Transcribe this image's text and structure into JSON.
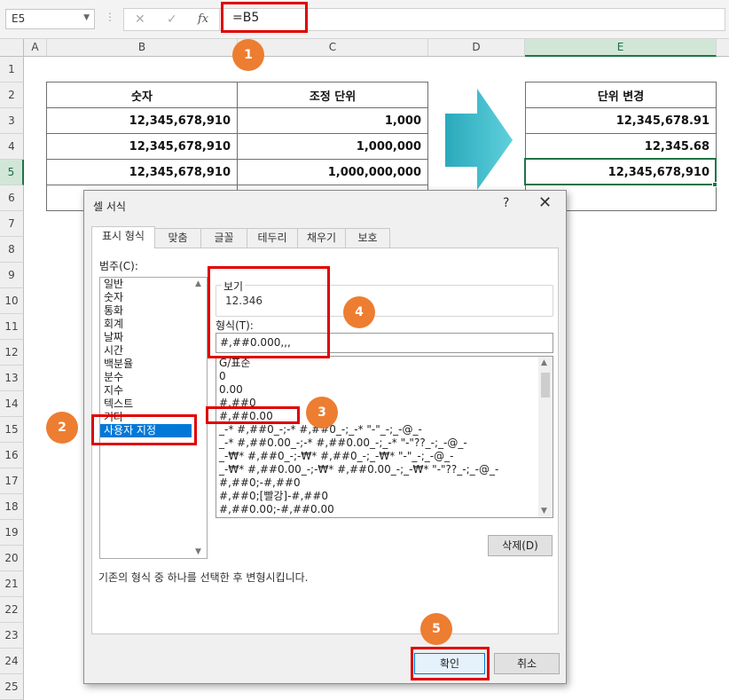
{
  "formula_bar": {
    "name_box": "E5",
    "cancel_icon": "✕",
    "enter_icon": "✓",
    "fx_icon": "fx",
    "formula": "=B5"
  },
  "columns": [
    "A",
    "B",
    "C",
    "D",
    "E"
  ],
  "rows": [
    "1",
    "2",
    "3",
    "4",
    "5",
    "6",
    "7",
    "8",
    "9",
    "10",
    "11",
    "12",
    "13",
    "14",
    "15",
    "16",
    "17",
    "18",
    "19",
    "20",
    "21",
    "22",
    "23",
    "24",
    "25"
  ],
  "left_table": {
    "headers": [
      "숫자",
      "조정 단위"
    ],
    "rows": [
      [
        "12,345,678,910",
        "1,000"
      ],
      [
        "12,345,678,910",
        "1,000,000"
      ],
      [
        "12,345,678,910",
        "1,000,000,000"
      ]
    ]
  },
  "right_table": {
    "header": "단위 변경",
    "values": [
      "12,345,678.91",
      "12,345.68",
      "12,345,678,910"
    ]
  },
  "dialog": {
    "title": "셀 서식",
    "help": "?",
    "close": "✕",
    "tabs": [
      "표시 형식",
      "맞춤",
      "글꼴",
      "테두리",
      "채우기",
      "보호"
    ],
    "category_label": "범주(C):",
    "categories": [
      "일반",
      "숫자",
      "통화",
      "회계",
      "날짜",
      "시간",
      "백분율",
      "분수",
      "지수",
      "텍스트",
      "기타",
      "사용자 지정"
    ],
    "selected_category": "사용자 지정",
    "sample_label": "보기",
    "sample_value": "12.346",
    "format_label": "형식(T):",
    "format_value": "#,##0.000,,,",
    "formats": [
      "G/표준",
      "0",
      "0.00",
      "#,##0",
      "#,##0.00",
      "_-* #,##0_-;-* #,##0_-;_-* \"-\"_-;_-@_-",
      "_-* #,##0.00_-;-* #,##0.00_-;_-* \"-\"??_-;_-@_-",
      "_-₩* #,##0_-;-₩* #,##0_-;_-₩* \"-\"_-;_-@_-",
      "_-₩* #,##0.00_-;-₩* #,##0.00_-;_-₩* \"-\"??_-;_-@_-",
      "#,##0;-#,##0",
      "#,##0;[빨강]-#,##0",
      "#,##0.00;-#,##0.00"
    ],
    "delete_button": "삭제(D)",
    "description": "기존의 형식 중 하나를 선택한 후 변형시킵니다.",
    "ok_button": "확인",
    "cancel_button": "취소"
  },
  "annotations": [
    "1",
    "2",
    "3",
    "4",
    "5"
  ],
  "colors": {
    "excel_green": "#217346",
    "arrow_teal": "#3ab8c8",
    "marker_red": "#e00000",
    "bubble_orange": "#ed7d31",
    "selection_blue": "#0078d7"
  }
}
